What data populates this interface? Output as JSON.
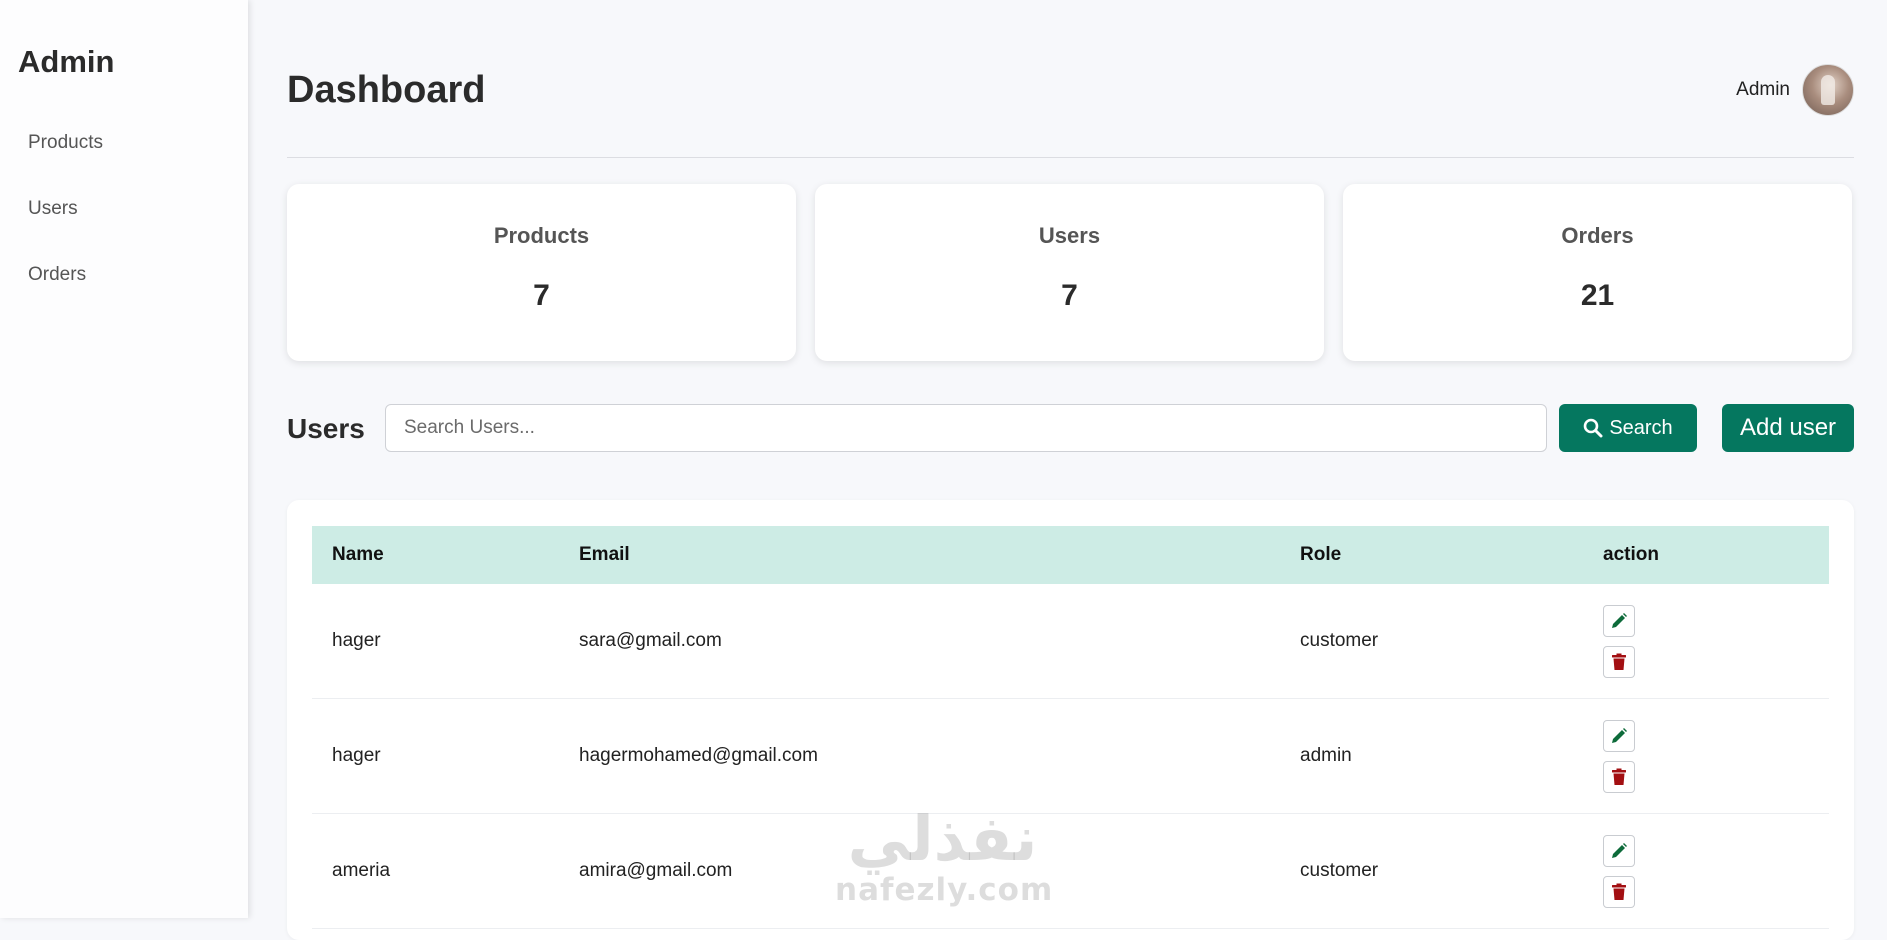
{
  "sidebar": {
    "brand": "Admin",
    "items": [
      {
        "label": "Products"
      },
      {
        "label": "Users"
      },
      {
        "label": "Orders"
      }
    ]
  },
  "header": {
    "title": "Dashboard",
    "user_name": "Admin"
  },
  "stats": [
    {
      "label": "Products",
      "value": "7"
    },
    {
      "label": "Users",
      "value": "7"
    },
    {
      "label": "Orders",
      "value": "21"
    }
  ],
  "users_section": {
    "title": "Users",
    "search_placeholder": "Search Users...",
    "search_value": "",
    "search_button": "Search",
    "add_button": "Add user"
  },
  "table": {
    "columns": [
      "Name",
      "Email",
      "Role",
      "action"
    ],
    "rows": [
      {
        "name": "hager",
        "email": "sara@gmail.com",
        "role": "customer"
      },
      {
        "name": "hager",
        "email": "hagermohamed@gmail.com",
        "role": "admin"
      },
      {
        "name": "ameria",
        "email": "amira@gmail.com",
        "role": "customer"
      }
    ]
  },
  "icons": {
    "search": "search-icon",
    "edit": "pencil-icon",
    "delete": "trash-icon"
  },
  "colors": {
    "accent": "#05775f",
    "table_header": "#cdece5",
    "edit_icon": "#0d6b3a",
    "delete_icon": "#a30f12"
  },
  "watermark": {
    "arabic": "نفذلي",
    "latin": "nafezly.com"
  }
}
